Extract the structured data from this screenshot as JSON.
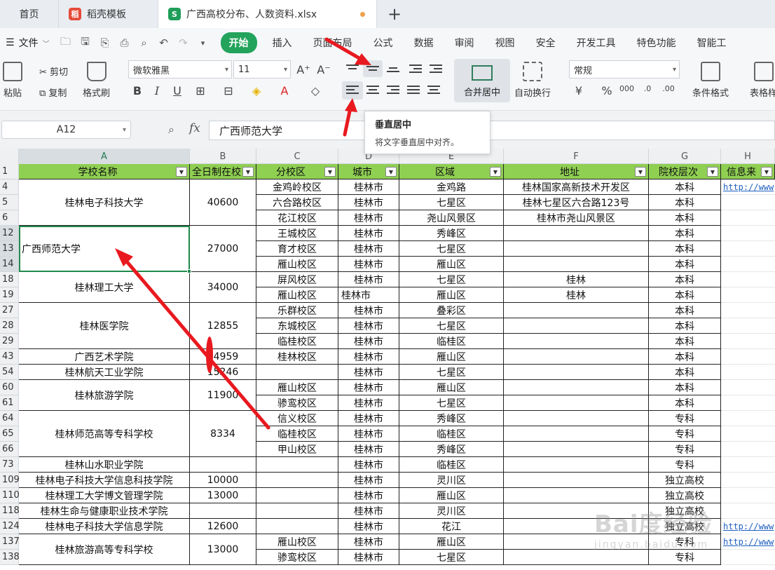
{
  "tabs": {
    "home": "首页",
    "template": "稻壳模板",
    "file": "广西高校分布、人数资料.xlsx",
    "add": "+"
  },
  "menu": {
    "file": "文件",
    "items": [
      "开始",
      "插入",
      "页面布局",
      "公式",
      "数据",
      "审阅",
      "视图",
      "安全",
      "开发工具",
      "特色功能",
      "智能工"
    ]
  },
  "ribbon": {
    "paste": "粘贴",
    "cut": "剪切",
    "copy": "复制",
    "format_painter": "格式刷",
    "font_name": "微软雅黑",
    "font_size": "11",
    "merge": "合并居中",
    "wrap": "自动换行",
    "number_format": "常规",
    "cond_format": "条件格式",
    "table_style": "表格样"
  },
  "formula_bar": {
    "cell_ref": "A12",
    "fx": "fx",
    "value": "广西师范大学"
  },
  "tooltip": {
    "title": "垂直居中",
    "desc": "将文字垂直居中对齐。"
  },
  "columns": [
    "A",
    "B",
    "C",
    "D",
    "E",
    "F",
    "G",
    "H"
  ],
  "headers": [
    "学校名称",
    "全日制在校",
    "分校区",
    "城市",
    "区域",
    "地址",
    "院校层次",
    "信息来"
  ],
  "row_numbers": [
    "1",
    "4",
    "5",
    "6",
    "12",
    "13",
    "14",
    "18",
    "19",
    "27",
    "28",
    "29",
    "43",
    "54",
    "60",
    "61",
    "64",
    "65",
    "66",
    "73",
    "109",
    "110",
    "118",
    "124",
    "137",
    "138"
  ],
  "schools": [
    {
      "name": "桂林电子科技大学",
      "students": "40600"
    },
    {
      "name": "广西师范大学",
      "students": "27000"
    },
    {
      "name": "桂林理工大学",
      "students": "34000"
    },
    {
      "name": "桂林医学院",
      "students": "12855"
    },
    {
      "name": "广西艺术学院",
      "students": "14959"
    },
    {
      "name": "桂林航天工业学院",
      "students": "15246"
    },
    {
      "name": "桂林旅游学院",
      "students": "11900"
    },
    {
      "name": "桂林师范高等专科学校",
      "students": "8334"
    },
    {
      "name": "桂林山水职业学院",
      "students": ""
    },
    {
      "name": "桂林电子科技大学信息科技学院",
      "students": "10000"
    },
    {
      "name": "桂林理工大学博文管理学院",
      "students": "13000"
    },
    {
      "name": "桂林生命与健康职业技术学院",
      "students": ""
    },
    {
      "name": "桂林电子科技大学信息学院",
      "students": "12600"
    },
    {
      "name": "桂林旅游高等专科学校",
      "students": "13000"
    }
  ],
  "rows": [
    {
      "campus": "金鸡岭校区",
      "city": "桂林市",
      "district": "金鸡路",
      "address": "桂林国家高新技术开发区",
      "level": "本科",
      "info": "http://www"
    },
    {
      "campus": "六合路校区",
      "city": "桂林市",
      "district": "七星区",
      "address": "桂林七星区六合路123号",
      "level": "本科",
      "info": ""
    },
    {
      "campus": "花江校区",
      "city": "桂林市",
      "district": "尧山风景区",
      "address": "桂林市尧山风景区",
      "level": "本科",
      "info": ""
    },
    {
      "campus": "王城校区",
      "city": "桂林市",
      "district": "秀峰区",
      "address": "",
      "level": "本科",
      "info": ""
    },
    {
      "campus": "育才校区",
      "city": "桂林市",
      "district": "七星区",
      "address": "",
      "level": "本科",
      "info": ""
    },
    {
      "campus": "雁山校区",
      "city": "桂林市",
      "district": "雁山区",
      "address": "",
      "level": "本科",
      "info": ""
    },
    {
      "campus": "屏风校区",
      "city": "桂林市",
      "district": "七星区",
      "address": "桂林",
      "level": "本科",
      "info": ""
    },
    {
      "campus": "雁山校区",
      "city": "桂林市",
      "district": "雁山区",
      "address": "桂林",
      "level": "本科",
      "info": ""
    },
    {
      "campus": "乐群校区",
      "city": "桂林市",
      "district": "叠彩区",
      "address": "",
      "level": "本科",
      "info": ""
    },
    {
      "campus": "东城校区",
      "city": "桂林市",
      "district": "七星区",
      "address": "",
      "level": "本科",
      "info": ""
    },
    {
      "campus": "临桂校区",
      "city": "桂林市",
      "district": "临桂区",
      "address": "",
      "level": "本科",
      "info": ""
    },
    {
      "campus": "桂林校区",
      "city": "桂林市",
      "district": "雁山区",
      "address": "",
      "level": "本科",
      "info": ""
    },
    {
      "campus": "",
      "city": "桂林市",
      "district": "七星区",
      "address": "",
      "level": "本科",
      "info": ""
    },
    {
      "campus": "雁山校区",
      "city": "桂林市",
      "district": "雁山区",
      "address": "",
      "level": "本科",
      "info": ""
    },
    {
      "campus": "骖鸾校区",
      "city": "桂林市",
      "district": "七星区",
      "address": "",
      "level": "本科",
      "info": ""
    },
    {
      "campus": "信义校区",
      "city": "桂林市",
      "district": "秀峰区",
      "address": "",
      "level": "专科",
      "info": ""
    },
    {
      "campus": "临桂校区",
      "city": "桂林市",
      "district": "临桂区",
      "address": "",
      "level": "专科",
      "info": ""
    },
    {
      "campus": "甲山校区",
      "city": "桂林市",
      "district": "秀峰区",
      "address": "",
      "level": "专科",
      "info": ""
    },
    {
      "campus": "",
      "city": "桂林市",
      "district": "临桂区",
      "address": "",
      "level": "专科",
      "info": ""
    },
    {
      "campus": "",
      "city": "桂林市",
      "district": "灵川区",
      "address": "",
      "level": "独立高校",
      "info": ""
    },
    {
      "campus": "",
      "city": "桂林市",
      "district": "雁山区",
      "address": "",
      "level": "独立高校",
      "info": ""
    },
    {
      "campus": "",
      "city": "桂林市",
      "district": "灵川区",
      "address": "",
      "level": "独立高校",
      "info": ""
    },
    {
      "campus": "",
      "city": "桂林市",
      "district": "花江",
      "address": "",
      "level": "独立高校",
      "info": "http://www"
    },
    {
      "campus": "雁山校区",
      "city": "桂林市",
      "district": "雁山区",
      "address": "",
      "level": "专科",
      "info": "http://www"
    },
    {
      "campus": "骖鸾校区",
      "city": "桂林市",
      "district": "七星区",
      "address": "",
      "level": "专科",
      "info": ""
    }
  ],
  "watermark": {
    "line1": "Bai度经验",
    "line2": "jingyan.baidu.com"
  },
  "colors": {
    "accent": "#23a35b",
    "header_fill": "#8fcf52",
    "selection": "#1f8a4c",
    "annotation": "#e8191f"
  }
}
